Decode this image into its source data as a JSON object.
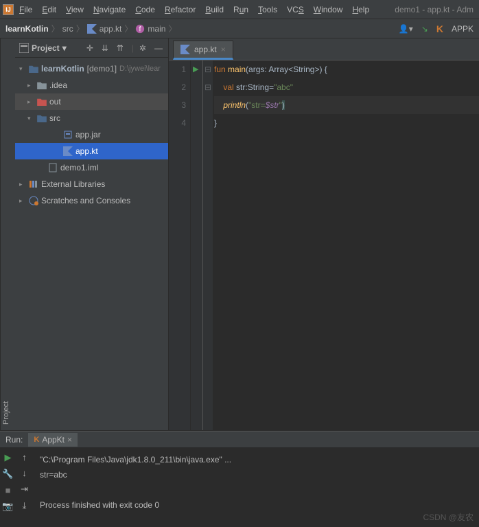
{
  "window_title": "demo1 - app.kt - Adm",
  "menu": [
    "File",
    "Edit",
    "View",
    "Navigate",
    "Code",
    "Refactor",
    "Build",
    "Run",
    "Tools",
    "VCS",
    "Window",
    "Help"
  ],
  "breadcrumb": {
    "project": "learnKotlin",
    "folder": "src",
    "file": "app.kt",
    "function": "main"
  },
  "nav_right": {
    "run_config": "APPK"
  },
  "project_panel": {
    "title": "Project",
    "root_name": "learnKotlin",
    "root_module": "[demo1]",
    "root_path": "D:\\jywei\\lear",
    "idea": ".idea",
    "out": "out",
    "src": "src",
    "app_jar": "app.jar",
    "app_kt": "app.kt",
    "demo_iml": "demo1.iml",
    "ext_lib": "External Libraries",
    "scratches": "Scratches and Consoles"
  },
  "editor_tab": "app.kt",
  "code": {
    "l1": {
      "kw1": "fun",
      "fn": "main",
      "args": "args",
      "ty": "Array",
      "gen": "String",
      "brace": "{"
    },
    "l2": {
      "kw": "val",
      "name": "str",
      "ty": "String",
      "str": "\"abc\""
    },
    "l3": {
      "fn": "println",
      "str_pre": "\"str=",
      "tmpl": "$str",
      "str_post": "\""
    },
    "l4": {
      "brace": "}"
    }
  },
  "gutter_lines": [
    "1",
    "2",
    "3",
    "4"
  ],
  "run": {
    "label": "Run:",
    "config": "AppKt",
    "line1": "\"C:\\Program Files\\Java\\jdk1.8.0_211\\bin\\java.exe\" ...",
    "line2": "str=abc",
    "line3": "Process finished with exit code 0"
  },
  "watermark": "CSDN @友农"
}
